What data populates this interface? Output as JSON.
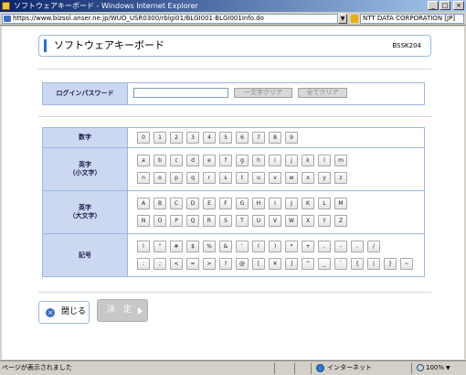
{
  "window": {
    "title": "ソフトウェアキーボード - Windows Internet Explorer",
    "minimize_glyph": "_",
    "maximize_glyph": "□",
    "close_glyph": "×"
  },
  "browser": {
    "url": "https://www.bizsol.anser.ne.jp/WUO_USR0300/rblgi01/BLGI001-BLGI001Info.do",
    "certificate": "NTT DATA CORPORATION [JP]",
    "dropdown_glyph": "▼"
  },
  "page": {
    "title": "ソフトウェアキーボード",
    "screen_code": "BSSK204"
  },
  "password": {
    "label": "ログインパスワード",
    "value": "",
    "clear_one": "一文字クリア",
    "clear_all": "全てクリア"
  },
  "keyboard": {
    "rows": [
      {
        "label": "数字",
        "lines": [
          [
            "0",
            "1",
            "2",
            "3",
            "4",
            "5",
            "6",
            "7",
            "8",
            "9"
          ]
        ]
      },
      {
        "label": "英字\n（小文字）",
        "lines": [
          [
            "a",
            "b",
            "c",
            "d",
            "e",
            "f",
            "g",
            "h",
            "i",
            "j",
            "k",
            "l",
            "m"
          ],
          [
            "n",
            "o",
            "p",
            "q",
            "r",
            "s",
            "t",
            "u",
            "v",
            "w",
            "x",
            "y",
            "z"
          ]
        ]
      },
      {
        "label": "英字\n（大文字）",
        "lines": [
          [
            "A",
            "B",
            "C",
            "D",
            "E",
            "F",
            "G",
            "H",
            "I",
            "J",
            "K",
            "L",
            "M"
          ],
          [
            "N",
            "O",
            "P",
            "Q",
            "R",
            "S",
            "T",
            "U",
            "V",
            "W",
            "X",
            "Y",
            "Z"
          ]
        ]
      },
      {
        "label": "記号",
        "lines": [
          [
            "!",
            "\"",
            "#",
            "$",
            "%",
            "&",
            "'",
            "(",
            ")",
            "*",
            "+",
            ",",
            "-",
            ".",
            "/"
          ],
          [
            ":",
            ";",
            "<",
            "=",
            ">",
            "?",
            "@",
            "[",
            "¥",
            "]",
            "^",
            "_",
            "`",
            "{",
            "|",
            "}",
            "~"
          ]
        ]
      }
    ]
  },
  "actions": {
    "close": "閉じる",
    "confirm": "決 定"
  },
  "statusbar": {
    "message": "ページが表示されました",
    "zone": "インターネット",
    "zoom": "100%",
    "zoom_drop_glyph": "▼"
  },
  "colors": {
    "title_bar": "#0a246a",
    "accent": "#2c6ed2",
    "label_bg": "#ccd8f0",
    "border": "#9cb8e0"
  }
}
